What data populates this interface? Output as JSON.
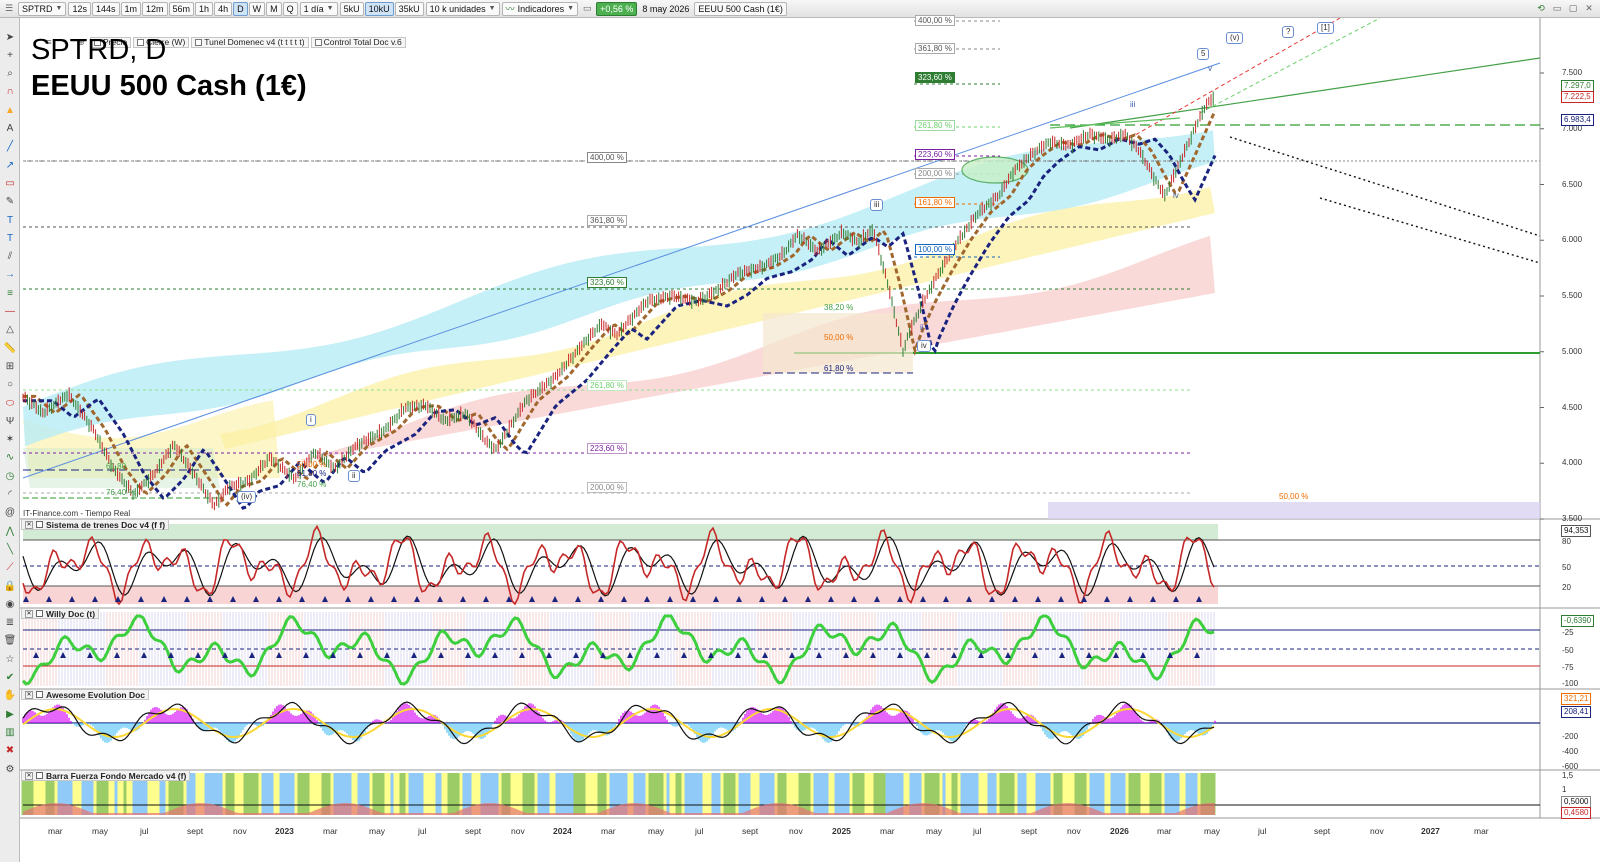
{
  "toolbar": {
    "symbol": "SPTRD",
    "timeframes": [
      "12s",
      "144s",
      "1m",
      "12m",
      "56m",
      "1h",
      "4h",
      "D",
      "W",
      "M",
      "Q"
    ],
    "active_timeframe": "D",
    "period": "1 día",
    "unit_buttons": [
      "5kU",
      "10kU",
      "35kU"
    ],
    "active_unit": "10kU",
    "quantity": "10 k unidades",
    "indicators": "Indicadores",
    "change": "+0,56 %",
    "date": "8 may 2026",
    "instrument": "EEUU 500 Cash (1€)"
  },
  "subbar": {
    "items": [
      "Precio",
      "Cierre (W)",
      "Tunel Domenec v4 (t t t t t)",
      "Control Total Doc v.6"
    ]
  },
  "chart": {
    "title_line1": "SPTRD, D",
    "title_line2": "EEUU 500 Cash (1€)",
    "watermark": "IT-Finance.com - Tiempo Real",
    "y_labels": [
      "7.500",
      "7.000",
      "6.500",
      "6.000",
      "5.500",
      "5.000",
      "4.500",
      "4.000",
      "3.500"
    ],
    "price_tags": [
      "7.297,0",
      "7.222,5",
      "6.983,4"
    ],
    "fibo_right": [
      "400,00 %",
      "361,80 %",
      "323,60 %",
      "261,80 %",
      "223,60 %",
      "200,00 %",
      "161,80 %",
      "100,00 %"
    ],
    "fibo_left": [
      "400,00 %",
      "361,80 %",
      "323,60 %",
      "261,80 %",
      "223,60 %",
      "200,00 %"
    ],
    "fibo_mid": [
      "38,20 %",
      "50,00 %",
      "61,80 %"
    ],
    "fibo_small": [
      "61,80",
      "76,40 %",
      "50,00 %",
      "61,80 %",
      "76,40 %"
    ],
    "fibo_far": "50,00 %",
    "waves": [
      "(iv)",
      "i",
      "ii",
      "iii",
      "iv",
      "ii",
      "iii",
      "iv",
      "v",
      "5",
      "(v)",
      "?",
      "[1]"
    ],
    "x_labels": [
      "mar",
      "may",
      "jul",
      "sept",
      "nov",
      "2023",
      "mar",
      "may",
      "jul",
      "sept",
      "nov",
      "2024",
      "mar",
      "may",
      "jul",
      "sept",
      "nov",
      "2025",
      "mar",
      "may",
      "jul",
      "sept",
      "nov",
      "2026",
      "mar",
      "may",
      "jul",
      "sept",
      "nov",
      "2027",
      "mar"
    ]
  },
  "panes": {
    "trenes": {
      "title": "Sistema de trenes Doc v4 (f f)",
      "y_labels": [
        "80",
        "50",
        "20"
      ],
      "tag": "94,353"
    },
    "willy": {
      "title": "Willy Doc (t)",
      "y_labels": [
        "-25",
        "-50",
        "-75",
        "-100"
      ],
      "tag": "-0,6390"
    },
    "awesome": {
      "title": "Awesome Evolution Doc",
      "y_labels": [
        "-200",
        "-400",
        "-600"
      ],
      "tags": [
        "321,21",
        "208,41"
      ]
    },
    "barra": {
      "title": "Barra Fuerza Fondo Mercado v4 (f)",
      "y_labels": [
        "1,5",
        "1",
        "0,5"
      ],
      "tags": [
        "0,5000",
        "0,4580"
      ]
    }
  },
  "colors": {
    "accent": "#2e7d32",
    "trend_blue": "#1a237e",
    "price_up": "#2e7d32",
    "price_down": "#c62828"
  }
}
